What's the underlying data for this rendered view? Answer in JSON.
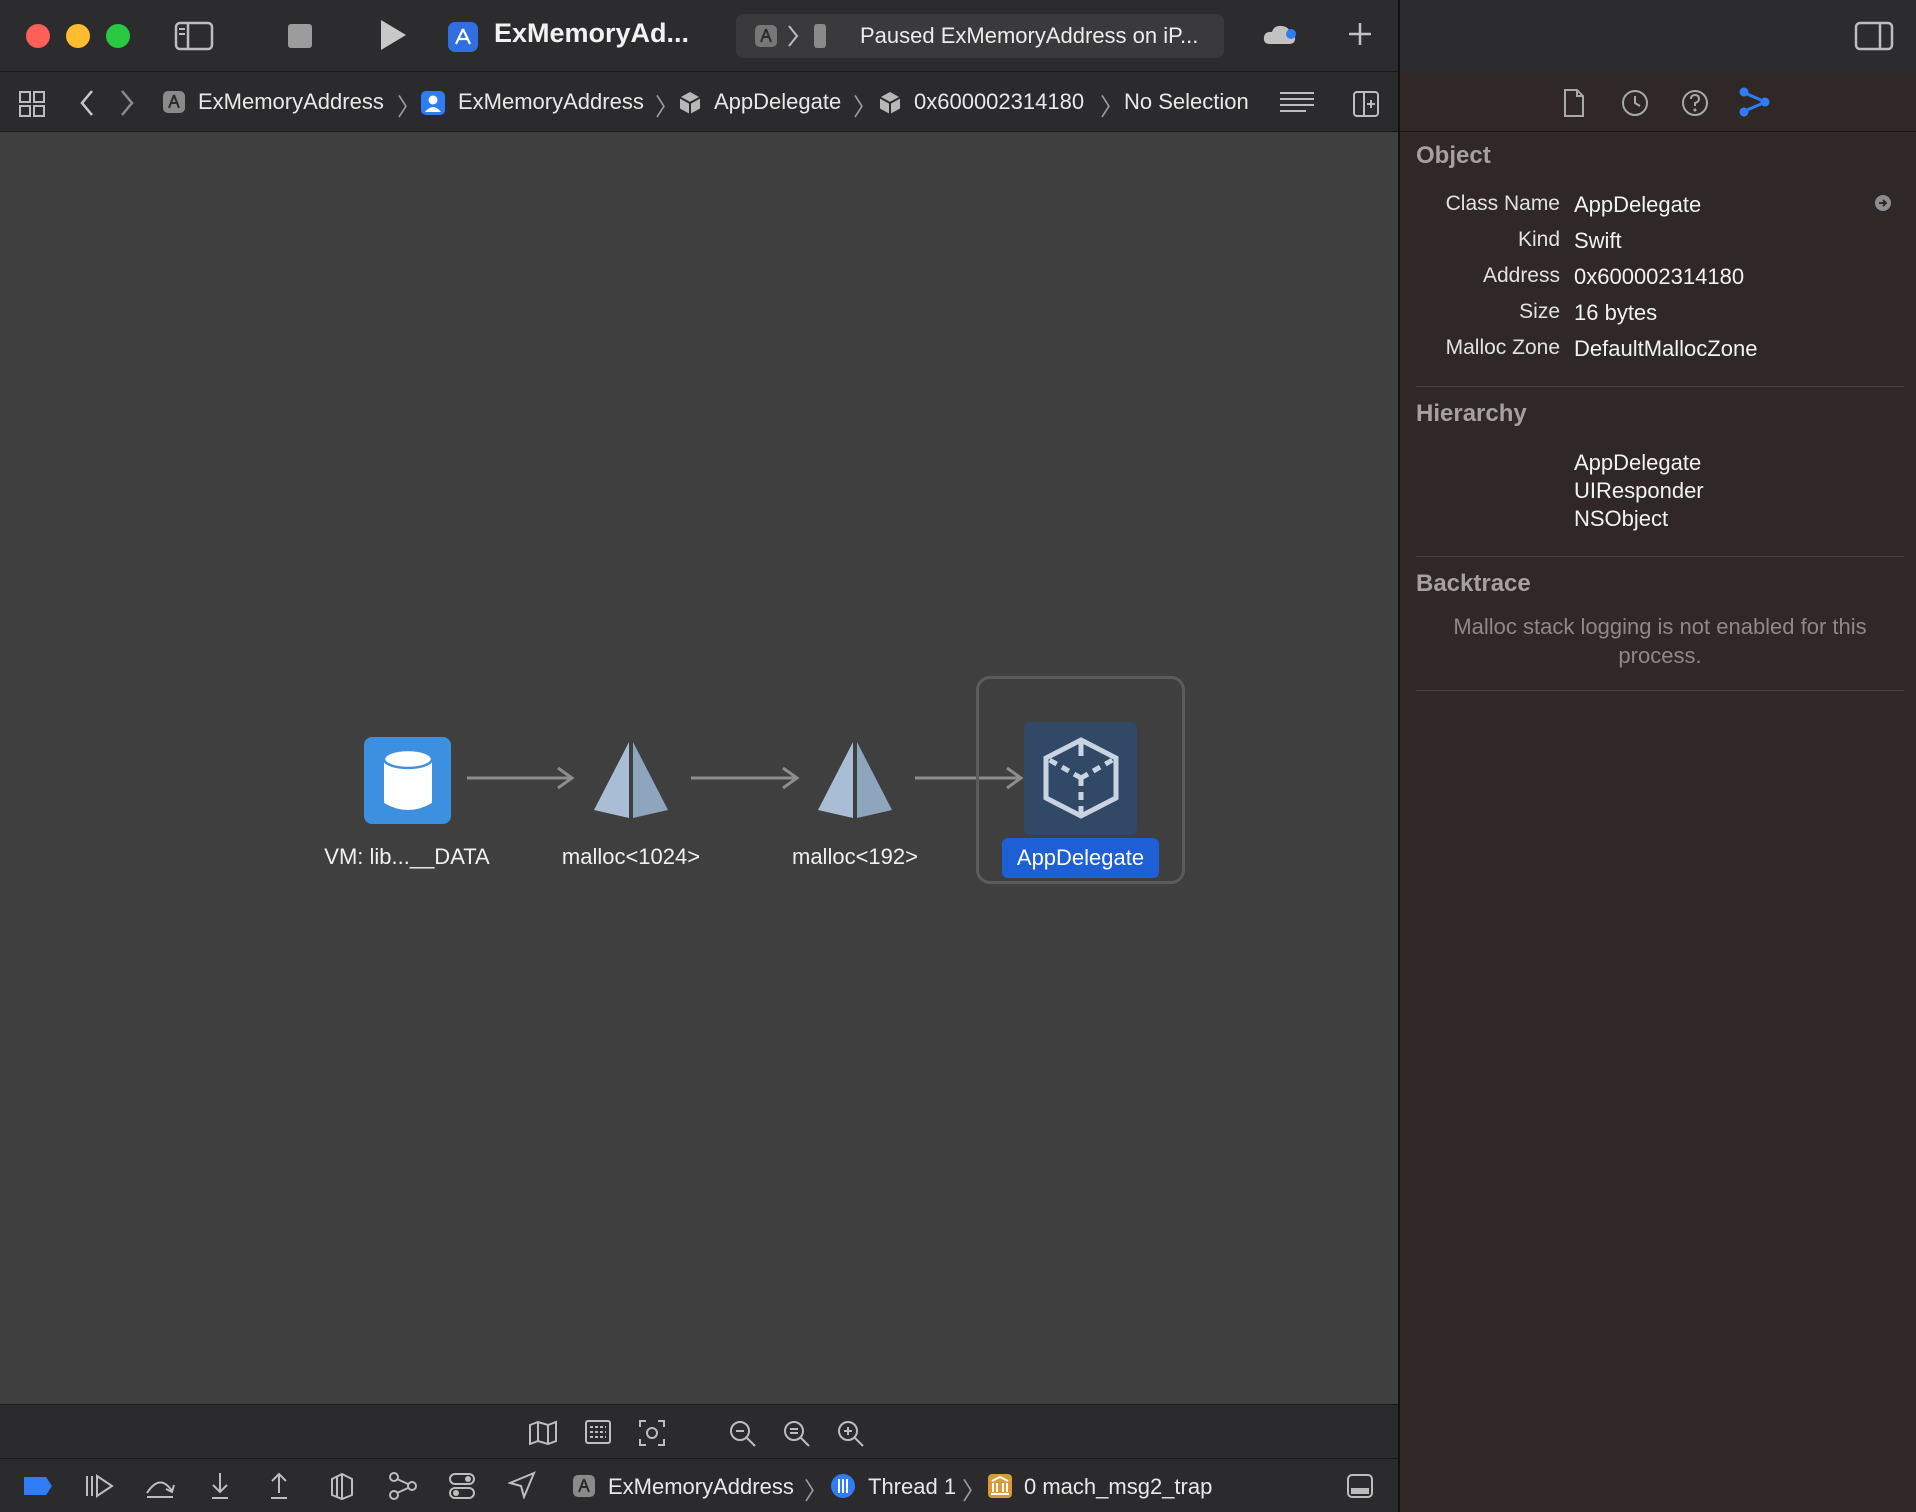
{
  "window": {
    "scheme_title": "ExMemoryAd...",
    "status": "Paused ExMemoryAddress on iP..."
  },
  "jumpbar": {
    "crumbs": [
      "ExMemoryAddress",
      "ExMemoryAddress",
      "AppDelegate",
      "0x600002314180",
      "No Selection"
    ]
  },
  "graph": {
    "nodes": [
      {
        "label": "VM: lib...__DATA",
        "kind": "vm-region"
      },
      {
        "label": "malloc<1024>",
        "kind": "malloc"
      },
      {
        "label": "malloc<192>",
        "kind": "malloc"
      },
      {
        "label": "AppDelegate",
        "kind": "object",
        "selected": true
      }
    ]
  },
  "debugbar": {
    "process": "ExMemoryAddress",
    "thread": "Thread 1",
    "frame": "0 mach_msg2_trap"
  },
  "inspector": {
    "object_title": "Object",
    "object": {
      "class_name_key": "Class Name",
      "class_name": "AppDelegate",
      "kind_key": "Kind",
      "kind": "Swift",
      "address_key": "Address",
      "address": "0x600002314180",
      "size_key": "Size",
      "size": "16 bytes",
      "zone_key": "Malloc Zone",
      "zone": "DefaultMallocZone"
    },
    "hierarchy_title": "Hierarchy",
    "hierarchy": [
      "AppDelegate",
      "UIResponder",
      "NSObject"
    ],
    "backtrace_title": "Backtrace",
    "backtrace_note": "Malloc stack logging is not enabled for this process."
  },
  "colors": {
    "accent": "#1f5fd6",
    "editor_bg": "#3f3f40",
    "inspector_bg": "#2f2826"
  }
}
